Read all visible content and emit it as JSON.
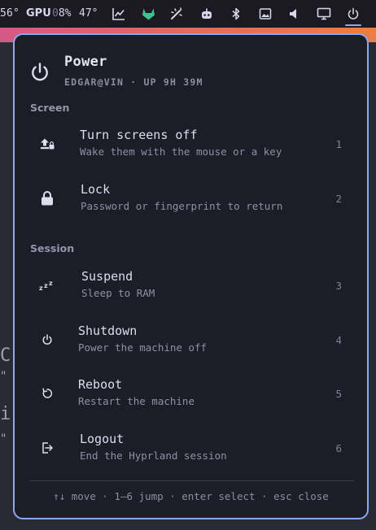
{
  "topbar": {
    "cpu_temp": "56°",
    "gpu_label": "GPU",
    "gpu_usage_prefix": "0",
    "gpu_usage": "8%",
    "gpu_temp": "47°",
    "icons": [
      "chart-icon",
      "gitlab-icon",
      "wand-icon",
      "robot-icon",
      "bluetooth-icon",
      "image-icon",
      "volume-icon",
      "monitor-icon",
      "power-icon"
    ]
  },
  "backdrop": {
    "line_a": "C",
    "line_b": "\"",
    "line_c": "i",
    "line_d": "\""
  },
  "panel": {
    "title": "Power",
    "subtitle": "EDGAR@VIN · UP 9H 39M",
    "sections": [
      {
        "label": "Screen",
        "items": [
          {
            "label": "Turn screens off",
            "description": "Wake them with the mouse or a key",
            "key": "1",
            "icon": "screen-off-icon"
          },
          {
            "label": "Lock",
            "description": "Password or fingerprint to return",
            "key": "2",
            "icon": "lock-icon"
          }
        ]
      },
      {
        "label": "Session",
        "items": [
          {
            "label": "Suspend",
            "description": "Sleep to RAM",
            "key": "3",
            "icon": "sleep-icon"
          },
          {
            "label": "Shutdown",
            "description": "Power the machine off",
            "key": "4",
            "icon": "power-icon"
          },
          {
            "label": "Reboot",
            "description": "Restart the machine",
            "key": "5",
            "icon": "restart-icon"
          },
          {
            "label": "Logout",
            "description": "End the Hyprland session",
            "key": "6",
            "icon": "logout-icon"
          }
        ]
      }
    ],
    "footer": "↑↓ move · 1–6 jump · enter select · esc close"
  },
  "colors": {
    "accent": "#8aa7f4",
    "panel_bg": "#1c1d27",
    "text": "#dcdeee",
    "muted": "#8e91a6"
  }
}
